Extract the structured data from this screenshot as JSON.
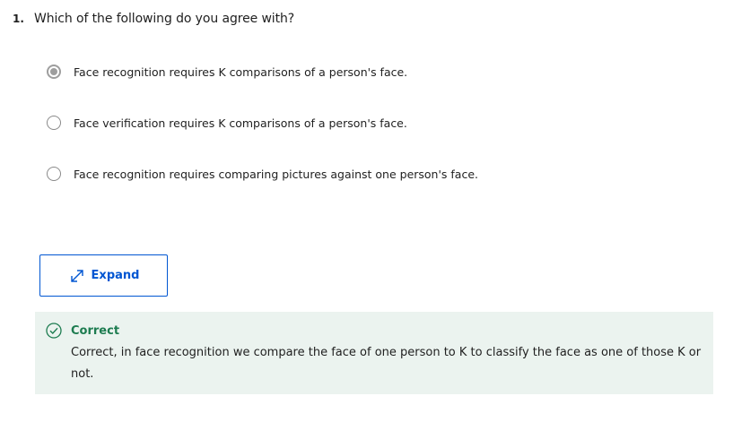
{
  "question": {
    "number": "1.",
    "text": "Which of the following do you agree with?"
  },
  "options": [
    {
      "label": "Face recognition requires K comparisons of a person's face.",
      "selected": true
    },
    {
      "label": "Face verification requires K comparisons of a person's face.",
      "selected": false
    },
    {
      "label": "Face recognition requires comparing pictures against one person's face.",
      "selected": false
    }
  ],
  "expand_button": {
    "label": "Expand",
    "icon": "expand-arrows-icon"
  },
  "feedback": {
    "status": "Correct",
    "icon": "check-circle-icon",
    "text": "Correct, in face recognition we compare the face of one person to K to classify the face as one of those K or not.",
    "status_color": "#1d7c50",
    "background_color": "#ebf3ef"
  },
  "colors": {
    "accent": "#0056d2"
  }
}
